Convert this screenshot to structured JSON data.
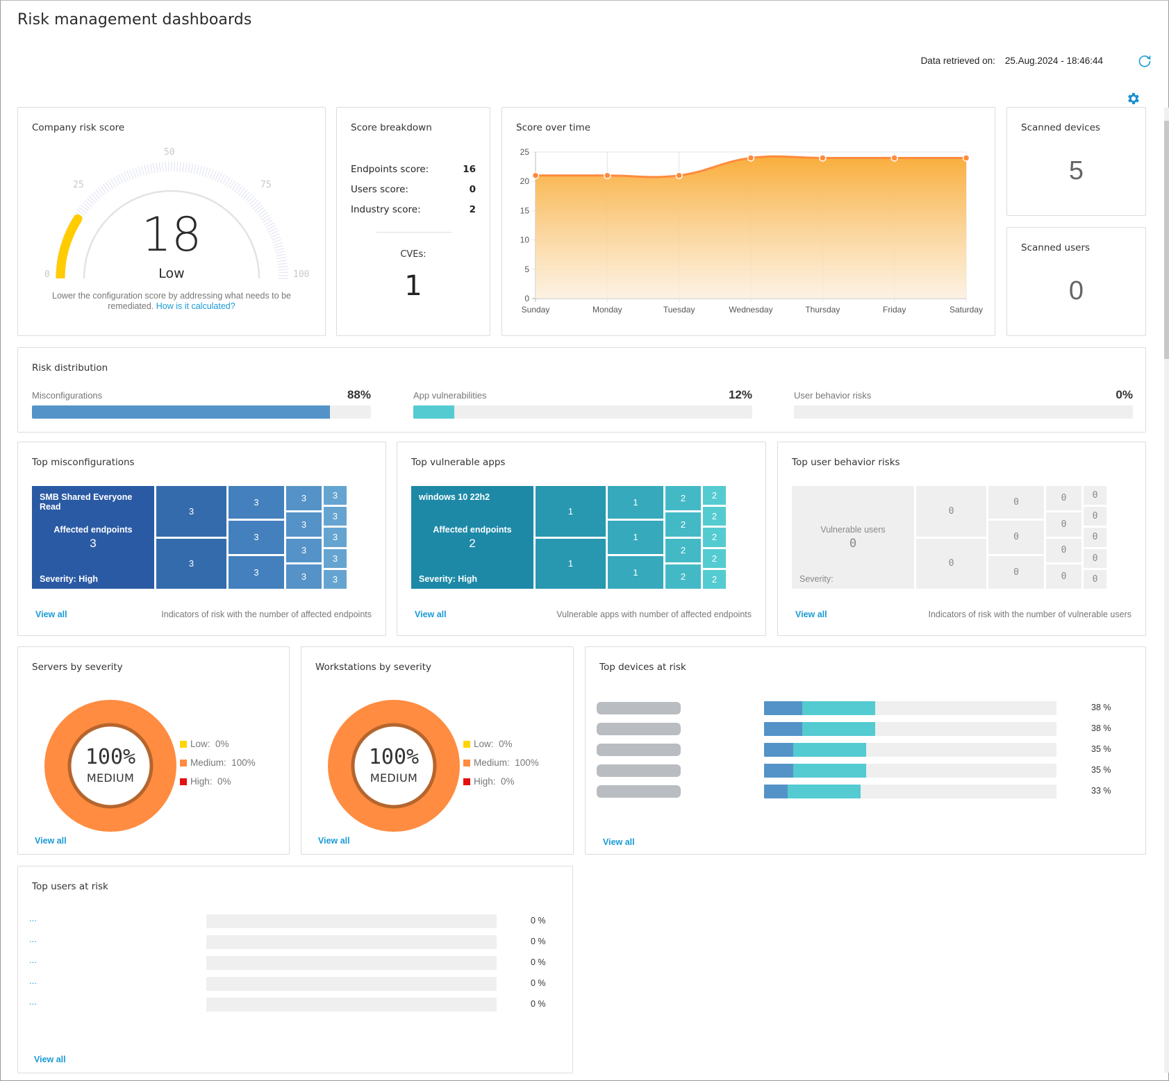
{
  "page": {
    "title": "Risk management dashboards"
  },
  "header": {
    "retrieved_label": "Data retrieved on:",
    "retrieved_value": "25.Aug.2024 - 18:46:44",
    "refresh_icon": "refresh-icon",
    "settings_icon": "gear-icon"
  },
  "colors": {
    "accent": "#1a9ad6",
    "gauge_fill": "#ffcc00",
    "misconfig_blue": "#5393c7",
    "app_teal": "#53cbd1",
    "chart_line": "#ff8a3d",
    "severity_low": "#ffd500",
    "severity_medium": "#ff8c40",
    "severity_high": "#e41010"
  },
  "company_risk": {
    "title": "Company risk score",
    "score": 18,
    "score_text": "18",
    "level": "Low",
    "min": 0,
    "max": 100,
    "ticks": [
      "0",
      "25",
      "50",
      "75",
      "100"
    ],
    "note": "Lower the configuration score by addressing what needs to be remediated.",
    "note_link": "How is it calculated?"
  },
  "score_breakdown": {
    "title": "Score breakdown",
    "rows": [
      {
        "label": "Endpoints score:",
        "value": "16"
      },
      {
        "label": "Users score:",
        "value": "0"
      },
      {
        "label": "Industry score:",
        "value": "2"
      }
    ],
    "cves_label": "CVEs:",
    "cves_value": "1"
  },
  "score_over_time": {
    "title": "Score over time"
  },
  "chart_data": {
    "type": "area",
    "title": "Score over time",
    "categories": [
      "Sunday",
      "Monday",
      "Tuesday",
      "Wednesday",
      "Thursday",
      "Friday",
      "Saturday"
    ],
    "series": [
      {
        "name": "Score",
        "values": [
          21,
          21,
          21,
          24,
          24,
          24,
          24
        ]
      }
    ],
    "yticks": [
      "0",
      "5",
      "10",
      "15",
      "20",
      "25"
    ],
    "ylim": [
      0,
      25
    ],
    "xlabel": "",
    "ylabel": "",
    "grid": true,
    "legend": "none"
  },
  "scanned_devices": {
    "title": "Scanned devices",
    "value": "5"
  },
  "scanned_users": {
    "title": "Scanned users",
    "value": "0"
  },
  "risk_distribution": {
    "title": "Risk distribution",
    "items": [
      {
        "label": "Misconfigurations",
        "percent_text": "88%",
        "percent": 88,
        "color": "#5393c7"
      },
      {
        "label": "App vulnerabilities",
        "percent_text": "12%",
        "percent": 12,
        "color": "#53cbd1"
      },
      {
        "label": "User behavior risks",
        "percent_text": "0%",
        "percent": 0,
        "color": "#5393c7"
      }
    ]
  },
  "top_misconfigurations": {
    "title": "Top misconfigurations",
    "main_name": "SMB Shared Everyone Read",
    "main_metric_label": "Affected endpoints",
    "main_metric_value": "3",
    "main_severity": "Severity: High",
    "tiles": [
      "3",
      "3",
      "3",
      "3",
      "3",
      "3",
      "3",
      "3",
      "3",
      "3",
      "3",
      "3",
      "3",
      "3"
    ],
    "view_all": "View all",
    "description": "Indicators of risk with the number of affected endpoints"
  },
  "top_vulnerable_apps": {
    "title": "Top vulnerable apps",
    "main_name": "windows 10 22h2",
    "main_metric_label": "Affected endpoints",
    "main_metric_value": "2",
    "main_severity": "Severity: High",
    "tiles": [
      "1",
      "1",
      "1",
      "1",
      "1",
      "2",
      "2",
      "2",
      "2",
      "2",
      "2",
      "2",
      "2",
      "2"
    ],
    "view_all": "View all",
    "description": "Vulnerable apps with number of affected endpoints"
  },
  "top_user_behavior_risks": {
    "title": "Top user behavior risks",
    "main_name": "",
    "main_metric_label": "Vulnerable users",
    "main_metric_value": "0",
    "main_severity": "Severity:",
    "tiles": [
      "0",
      "0",
      "0",
      "0",
      "0",
      "0",
      "0",
      "0",
      "0",
      "0",
      "0",
      "0",
      "0",
      "0"
    ],
    "view_all": "View all",
    "description": "Indicators of risk with the number of vulnerable users"
  },
  "servers_by_severity": {
    "title": "Servers by severity",
    "center_pct": "100%",
    "center_label": "MEDIUM",
    "legend": [
      {
        "label": "Low:",
        "value": "0%",
        "percent": 0,
        "color": "#ffd500"
      },
      {
        "label": "Medium:",
        "value": "100%",
        "percent": 100,
        "color": "#ff8c40"
      },
      {
        "label": "High:",
        "value": "0%",
        "percent": 0,
        "color": "#e41010"
      }
    ],
    "view_all": "View all"
  },
  "workstations_by_severity": {
    "title": "Workstations by severity",
    "center_pct": "100%",
    "center_label": "MEDIUM",
    "legend": [
      {
        "label": "Low:",
        "value": "0%",
        "percent": 0,
        "color": "#ffd500"
      },
      {
        "label": "Medium:",
        "value": "100%",
        "percent": 100,
        "color": "#ff8c40"
      },
      {
        "label": "High:",
        "value": "0%",
        "percent": 0,
        "color": "#e41010"
      }
    ],
    "view_all": "View all"
  },
  "top_devices_at_risk": {
    "title": "Top devices at risk",
    "rows": [
      {
        "pct_text": "38 %",
        "misconfig_pct": 13,
        "app_pct": 25
      },
      {
        "pct_text": "38 %",
        "misconfig_pct": 13,
        "app_pct": 25
      },
      {
        "pct_text": "35 %",
        "misconfig_pct": 10,
        "app_pct": 25
      },
      {
        "pct_text": "35 %",
        "misconfig_pct": 10,
        "app_pct": 25
      },
      {
        "pct_text": "33 %",
        "misconfig_pct": 8,
        "app_pct": 25
      }
    ],
    "view_all": "View all"
  },
  "top_users_at_risk": {
    "title": "Top users at risk",
    "rows": [
      {
        "name": "...",
        "pct_text": "0 %",
        "pct": 0
      },
      {
        "name": "...",
        "pct_text": "0 %",
        "pct": 0
      },
      {
        "name": "...",
        "pct_text": "0 %",
        "pct": 0
      },
      {
        "name": "...",
        "pct_text": "0 %",
        "pct": 0
      },
      {
        "name": "...",
        "pct_text": "0 %",
        "pct": 0
      }
    ],
    "view_all": "View all"
  }
}
